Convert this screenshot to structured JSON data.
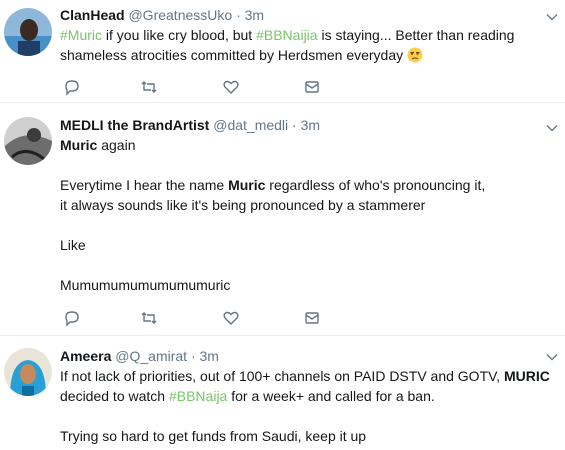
{
  "tweets": [
    {
      "name": "ClanHead",
      "handle": "@GreatnessUko",
      "dot": "·",
      "time": "3m",
      "parts": {
        "hashtag1": "#Muric",
        "t1": " if you like cry blood, but ",
        "hashtag2": "#BBNaijia",
        "t2": " is staying... Better than reading shameless atrocities committed by Herdsmen everyday"
      },
      "emoji": "unamused-face-emoji"
    },
    {
      "name": "MEDLI the BrandArtist",
      "handle": "@dat_medli",
      "dot": "·",
      "time": "3m",
      "parts": {
        "l1_bold": "Muric",
        "l1_rest": " again",
        "p2_a": "Everytime I hear the name ",
        "p2_bold": "Muric",
        "p2_b": " regardless of who's pronouncing it,",
        "p2_c": "it always sounds like it's being pronounced by a stammerer",
        "p3": "Like",
        "p4": "Mumumumumumumumuric"
      }
    },
    {
      "name": "Ameera",
      "handle": "@Q_amirat",
      "dot": "·",
      "time": "3m",
      "parts": {
        "a": "If not lack of priorities, out of 100+ channels on PAID DSTV and GOTV, ",
        "bold": "MURIC",
        "b": " decided to watch ",
        "hashtag": "#BBNaija",
        "c": " for a week+ and called for a ban.",
        "p2": "Trying so hard to get funds from Saudi, keep it up"
      }
    }
  ],
  "icons": {
    "reply": "reply-icon",
    "retweet": "retweet-icon",
    "like": "heart-icon",
    "dm": "envelope-icon",
    "caret": "chevron-down-icon"
  },
  "colors": {
    "hashtag": "#79c36a",
    "muted": "#657786",
    "border": "#e6ecf0"
  }
}
